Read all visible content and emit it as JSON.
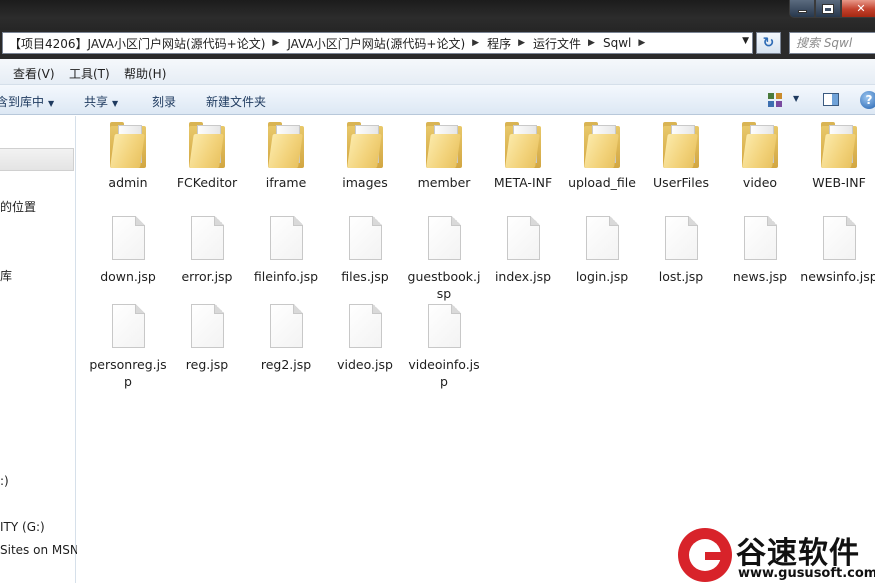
{
  "window": {
    "ghost_title": "",
    "close_glyph": "✕"
  },
  "address": {
    "crumbs": [
      "【项目4206】JAVA小区门户网站(源代码+论文)",
      "JAVA小区门户网站(源代码+论文)",
      "程序",
      "运行文件",
      "Sqwl"
    ],
    "search_placeholder": "搜索 Sqwl"
  },
  "menu": {
    "items": [
      "查看(V)",
      "工具(T)",
      "帮助(H)"
    ]
  },
  "toolbar": {
    "include_library": "含到库中",
    "share": "共享",
    "burn": "刻录",
    "new_folder": "新建文件夹"
  },
  "nav": {
    "items": [
      "的位置",
      "库",
      ":)",
      "ITY (G:)",
      "Sites on MSN"
    ]
  },
  "folders": [
    "admin",
    "FCKeditor",
    "iframe",
    "images",
    "member",
    "META-INF",
    "upload_file",
    "UserFiles",
    "video",
    "WEB-INF"
  ],
  "files": [
    "down.jsp",
    "error.jsp",
    "fileinfo.jsp",
    "files.jsp",
    "guestbook.jsp",
    "index.jsp",
    "login.jsp",
    "lost.jsp",
    "news.jsp",
    "newsinfo.jsp",
    "personreg.jsp",
    "reg.jsp",
    "reg2.jsp",
    "video.jsp",
    "videoinfo.jsp"
  ],
  "watermark": {
    "name": "谷速软件",
    "url": "www.gususoft.com"
  }
}
